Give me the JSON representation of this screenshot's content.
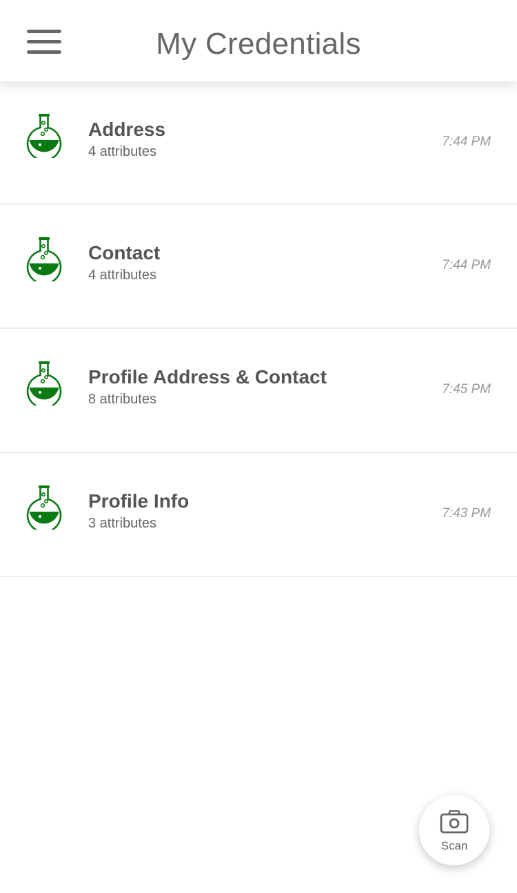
{
  "header": {
    "title": "My Credentials",
    "menu_icon": "hamburger-menu-icon"
  },
  "colors": {
    "accent_green": "#0a7a12",
    "title_gray": "#666666",
    "time_gray": "#999999"
  },
  "credentials": [
    {
      "name": "Address",
      "attributes": "4 attributes",
      "time": "7:44 PM",
      "icon": "flask-icon"
    },
    {
      "name": "Contact",
      "attributes": "4 attributes",
      "time": "7:44 PM",
      "icon": "flask-icon"
    },
    {
      "name": "Profile Address & Contact",
      "attributes": "8 attributes",
      "time": "7:45 PM",
      "icon": "flask-icon"
    },
    {
      "name": "Profile Info",
      "attributes": "3 attributes",
      "time": "7:43 PM",
      "icon": "flask-icon"
    }
  ],
  "scan": {
    "label": "Scan",
    "icon": "camera-icon"
  }
}
